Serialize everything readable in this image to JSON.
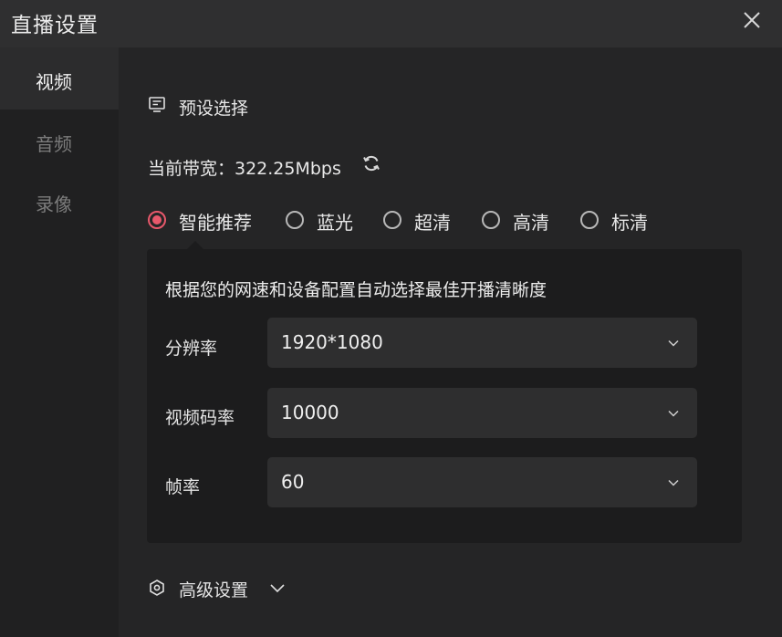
{
  "window": {
    "title": "直播设置"
  },
  "sidebar": {
    "items": [
      {
        "label": "视频",
        "active": true
      },
      {
        "label": "音频",
        "active": false
      },
      {
        "label": "录像",
        "active": false
      }
    ]
  },
  "preset": {
    "heading": "预设选择",
    "bandwidth_text": "当前带宽：322.25Mbps",
    "options": [
      {
        "label": "智能推荐",
        "selected": true
      },
      {
        "label": "蓝光",
        "selected": false
      },
      {
        "label": "超清",
        "selected": false
      },
      {
        "label": "高清",
        "selected": false
      },
      {
        "label": "标清",
        "selected": false
      }
    ],
    "description": "根据您的网速和设备配置自动选择最佳开播清晰度",
    "fields": [
      {
        "label": "分辨率",
        "value": "1920*1080"
      },
      {
        "label": "视频码率",
        "value": "10000"
      },
      {
        "label": "帧率",
        "value": "60"
      }
    ]
  },
  "advanced": {
    "label": "高级设置"
  },
  "colors": {
    "accent": "#e8586b",
    "background": "#252526",
    "panel": "#1c1c1d",
    "select": "#2e2e2f"
  },
  "icons": {
    "close": "close-icon",
    "preset": "preset-list-icon",
    "refresh": "refresh-icon",
    "advanced": "hexagon-settings-icon",
    "dropdown": "chevron-down-icon"
  }
}
